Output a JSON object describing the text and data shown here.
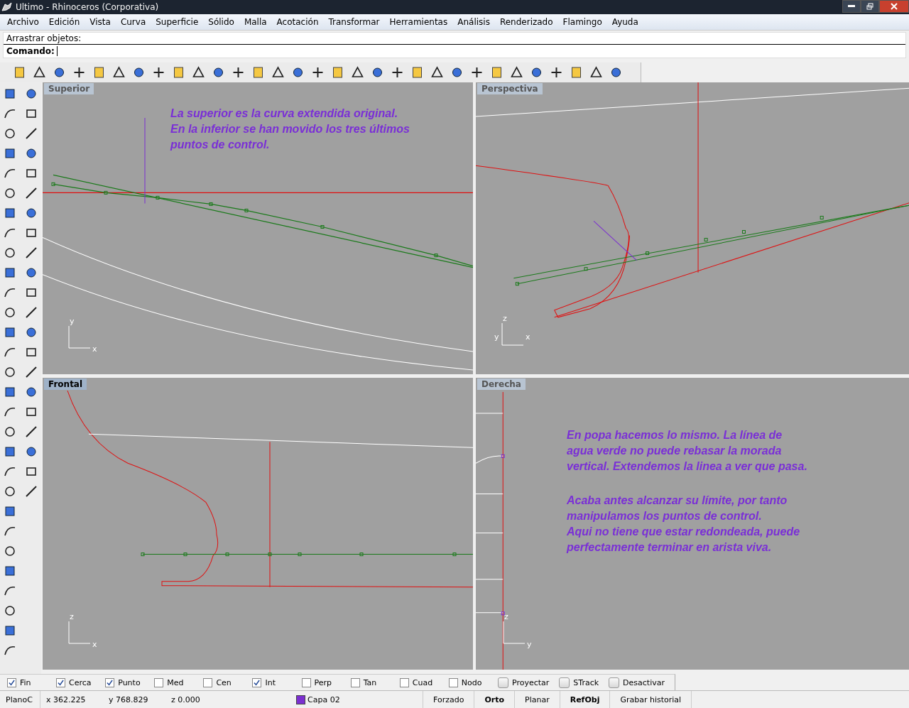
{
  "window": {
    "title": "Ultimo - Rhinoceros (Corporativa)"
  },
  "menu": [
    "Archivo",
    "Edición",
    "Vista",
    "Curva",
    "Superficie",
    "Sólido",
    "Malla",
    "Acotación",
    "Transformar",
    "Herramientas",
    "Análisis",
    "Renderizado",
    "Flamingo",
    "Ayuda"
  ],
  "command": {
    "history": "Arrastrar objetos:",
    "label": "Comando:"
  },
  "viewports": [
    {
      "kind": "superior",
      "title": "Superior",
      "selected": false,
      "axes": [
        "y",
        "x"
      ],
      "notes": [
        "La superior es la curva extendida original.\nEn la  inferior se han movido los tres últimos\npuntos de control."
      ]
    },
    {
      "kind": "perspectiva",
      "title": "Perspectiva",
      "selected": false,
      "axes": [
        "z",
        "y",
        "x"
      ]
    },
    {
      "kind": "frontal",
      "title": "Frontal",
      "selected": true,
      "axes": [
        "z",
        "x"
      ]
    },
    {
      "kind": "derecha",
      "title": "Derecha",
      "selected": false,
      "axes": [
        "z",
        "y"
      ],
      "notes": [
        "En popa hacemos lo mismo. La línea de\nagua verde no puede rebasar la morada\nvertical. Extendemos la linea a ver que pasa.",
        "Acaba antes alcanzar su límite, por tanto\nmanipulamos los puntos de control.\nAqui no tiene que estar redondeada, puede\nperfectamente terminar en arista viva."
      ]
    }
  ],
  "osnaps": [
    {
      "kind": "checkbox",
      "label": "Fin",
      "checked": true
    },
    {
      "kind": "checkbox",
      "label": "Cerca",
      "checked": true
    },
    {
      "kind": "checkbox",
      "label": "Punto",
      "checked": true
    },
    {
      "kind": "checkbox",
      "label": "Med",
      "checked": false
    },
    {
      "kind": "checkbox",
      "label": "Cen",
      "checked": false
    },
    {
      "kind": "checkbox",
      "label": "Int",
      "checked": true
    },
    {
      "kind": "checkbox",
      "label": "Perp",
      "checked": false
    },
    {
      "kind": "checkbox",
      "label": "Tan",
      "checked": false
    },
    {
      "kind": "checkbox",
      "label": "Cuad",
      "checked": false
    },
    {
      "kind": "checkbox",
      "label": "Nodo",
      "checked": false
    },
    {
      "kind": "toggle",
      "label": "Proyectar",
      "checked": false
    },
    {
      "kind": "toggle",
      "label": "STrack",
      "checked": false
    },
    {
      "kind": "toggle",
      "label": "Desactivar",
      "checked": false
    }
  ],
  "status_bar": {
    "plane": "PlanoC",
    "x": "x 362.225",
    "y": "y 768.829",
    "z": "z 0.000",
    "layer": {
      "name": "Capa 02",
      "color": "#7b2fd0"
    },
    "modes": [
      {
        "label": "Forzado",
        "on": false
      },
      {
        "label": "Orto",
        "on": true
      },
      {
        "label": "Planar",
        "on": false
      },
      {
        "label": "RefObj",
        "on": true
      },
      {
        "label": "Grabar historial",
        "on": false
      }
    ]
  }
}
